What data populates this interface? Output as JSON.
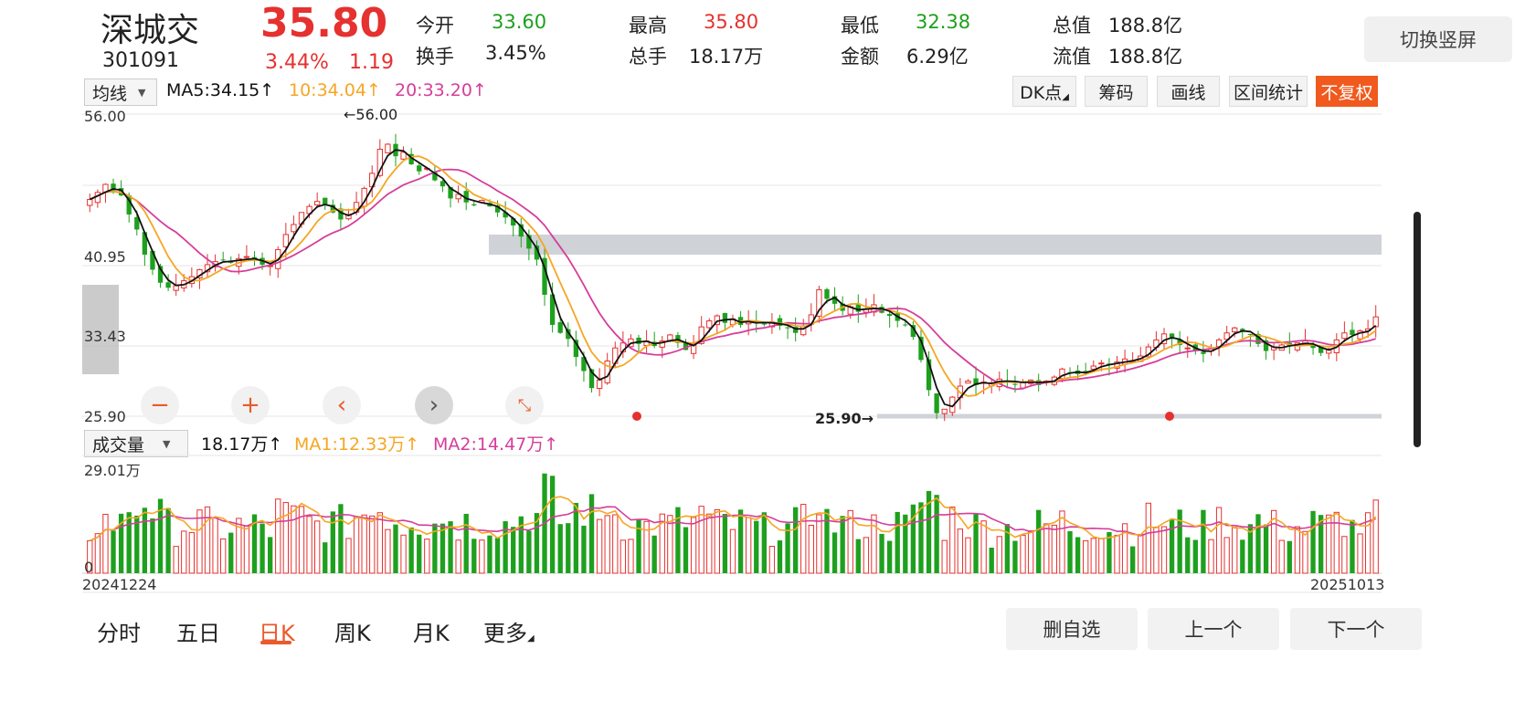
{
  "header": {
    "name": "深城交",
    "code": "301091",
    "price": "35.80",
    "change_pct": "3.44%",
    "change": "1.19",
    "open_label": "今开",
    "open": "33.60",
    "turnover_label": "换手",
    "turnover": "3.45%",
    "high_label": "最高",
    "high": "35.80",
    "volume_label": "总手",
    "volume": "18.17万",
    "low_label": "最低",
    "low": "32.38",
    "amount_label": "金额",
    "amount": "6.29亿",
    "mktcap_label": "总值",
    "mktcap": "188.8亿",
    "float_label": "流值",
    "float": "188.8亿",
    "switch_label": "切换竖屏"
  },
  "toolbar": {
    "ma_select": "均线",
    "ma5": "MA5:34.15",
    "ma10": "10:34.04",
    "ma20": "20:33.20",
    "arrow": "↑",
    "dk_label": "DK点",
    "chip_label": "筹码",
    "draw_label": "画线",
    "range_label": "区间统计",
    "fq_label": "不复权"
  },
  "price_chart": {
    "y_labels": [
      "56.00",
      "40.95",
      "33.43",
      "25.90"
    ],
    "high_marker": "56.00",
    "low_marker": "25.90"
  },
  "nav_icons": [
    "minus-icon",
    "plus-icon",
    "chevron-left-icon",
    "chevron-right-icon",
    "shrink-icon"
  ],
  "volume_bar": {
    "select": "成交量",
    "value": "18.17万",
    "ma1": "MA1:12.33万",
    "ma2": "MA2:14.47万",
    "arrow": "↑",
    "y_max": "29.01万",
    "y_zero": "0",
    "date_start": "20241224",
    "date_end": "20251013"
  },
  "tabs": [
    "分时",
    "五日",
    "日K",
    "周K",
    "月K",
    "更多"
  ],
  "active_tab": "日K",
  "buttons": {
    "remove_fav": "删自选",
    "prev": "上一个",
    "next": "下一个"
  },
  "colors": {
    "up": "#e5312f",
    "down": "#1ea01e",
    "ma5": "#111111",
    "ma10": "#f5a623",
    "ma20": "#d63d9a",
    "accent": "#ea5a2a"
  },
  "chart_data": {
    "type": "candlestick",
    "ylim": [
      25.9,
      56.0
    ],
    "close_series": [
      47.5,
      48.2,
      49.0,
      48.4,
      47.9,
      46.0,
      44.5,
      42.0,
      40.5,
      39.2,
      38.7,
      38.9,
      39.4,
      39.8,
      40.5,
      41.0,
      41.3,
      41.5,
      41.2,
      41.6,
      41.8,
      41.4,
      41.0,
      40.9,
      42.5,
      44.0,
      45.0,
      46.2,
      46.8,
      47.3,
      46.9,
      46.2,
      45.5,
      46.0,
      47.2,
      48.6,
      50.1,
      52.5,
      53.0,
      51.8,
      52.2,
      51.0,
      50.3,
      50.6,
      49.4,
      48.8,
      47.6,
      48.0,
      47.2,
      46.9,
      47.4,
      46.8,
      46.2,
      45.7,
      44.9,
      43.8,
      42.6,
      41.5,
      38.0,
      35.0,
      34.2,
      33.6,
      31.8,
      30.4,
      28.7,
      29.5,
      31.4,
      32.7,
      33.2,
      33.6,
      33.1,
      33.4,
      32.9,
      33.4,
      34.0,
      33.2,
      32.5,
      33.1,
      34.8,
      35.4,
      35.9,
      35.2,
      35.6,
      35.0,
      35.4,
      35.2,
      35.1,
      35.3,
      34.9,
      34.7,
      34.2,
      34.9,
      36.0,
      38.5,
      37.6,
      37.1,
      36.4,
      36.8,
      36.3,
      36.6,
      37.0,
      36.2,
      35.9,
      35.4,
      35.0,
      33.8,
      31.5,
      28.5,
      26.2,
      26.6,
      27.8,
      28.9,
      29.4,
      29.0,
      29.3,
      29.2,
      29.6,
      29.4,
      29.1,
      29.3,
      29.5,
      29.0,
      29.4,
      29.8,
      30.6,
      30.2,
      30.1,
      30.4,
      30.9,
      31.2,
      31.0,
      31.3,
      31.6,
      31.4,
      31.9,
      32.8,
      33.5,
      34.1,
      33.6,
      33.0,
      32.7,
      32.4,
      32.1,
      32.6,
      33.5,
      34.2,
      34.7,
      34.3,
      34.0,
      33.1,
      32.4,
      32.8,
      33.0,
      32.9,
      33.2,
      33.4,
      32.7,
      32.2,
      32.6,
      33.5,
      34.2,
      34.0,
      34.4,
      34.6,
      35.8
    ],
    "ma5_last": 34.15,
    "ma10_last": 34.04,
    "ma20_last": 33.2,
    "volume_max": 29.01,
    "volume_last": 18.17,
    "x_start": "20241224",
    "x_end": "20251013"
  }
}
